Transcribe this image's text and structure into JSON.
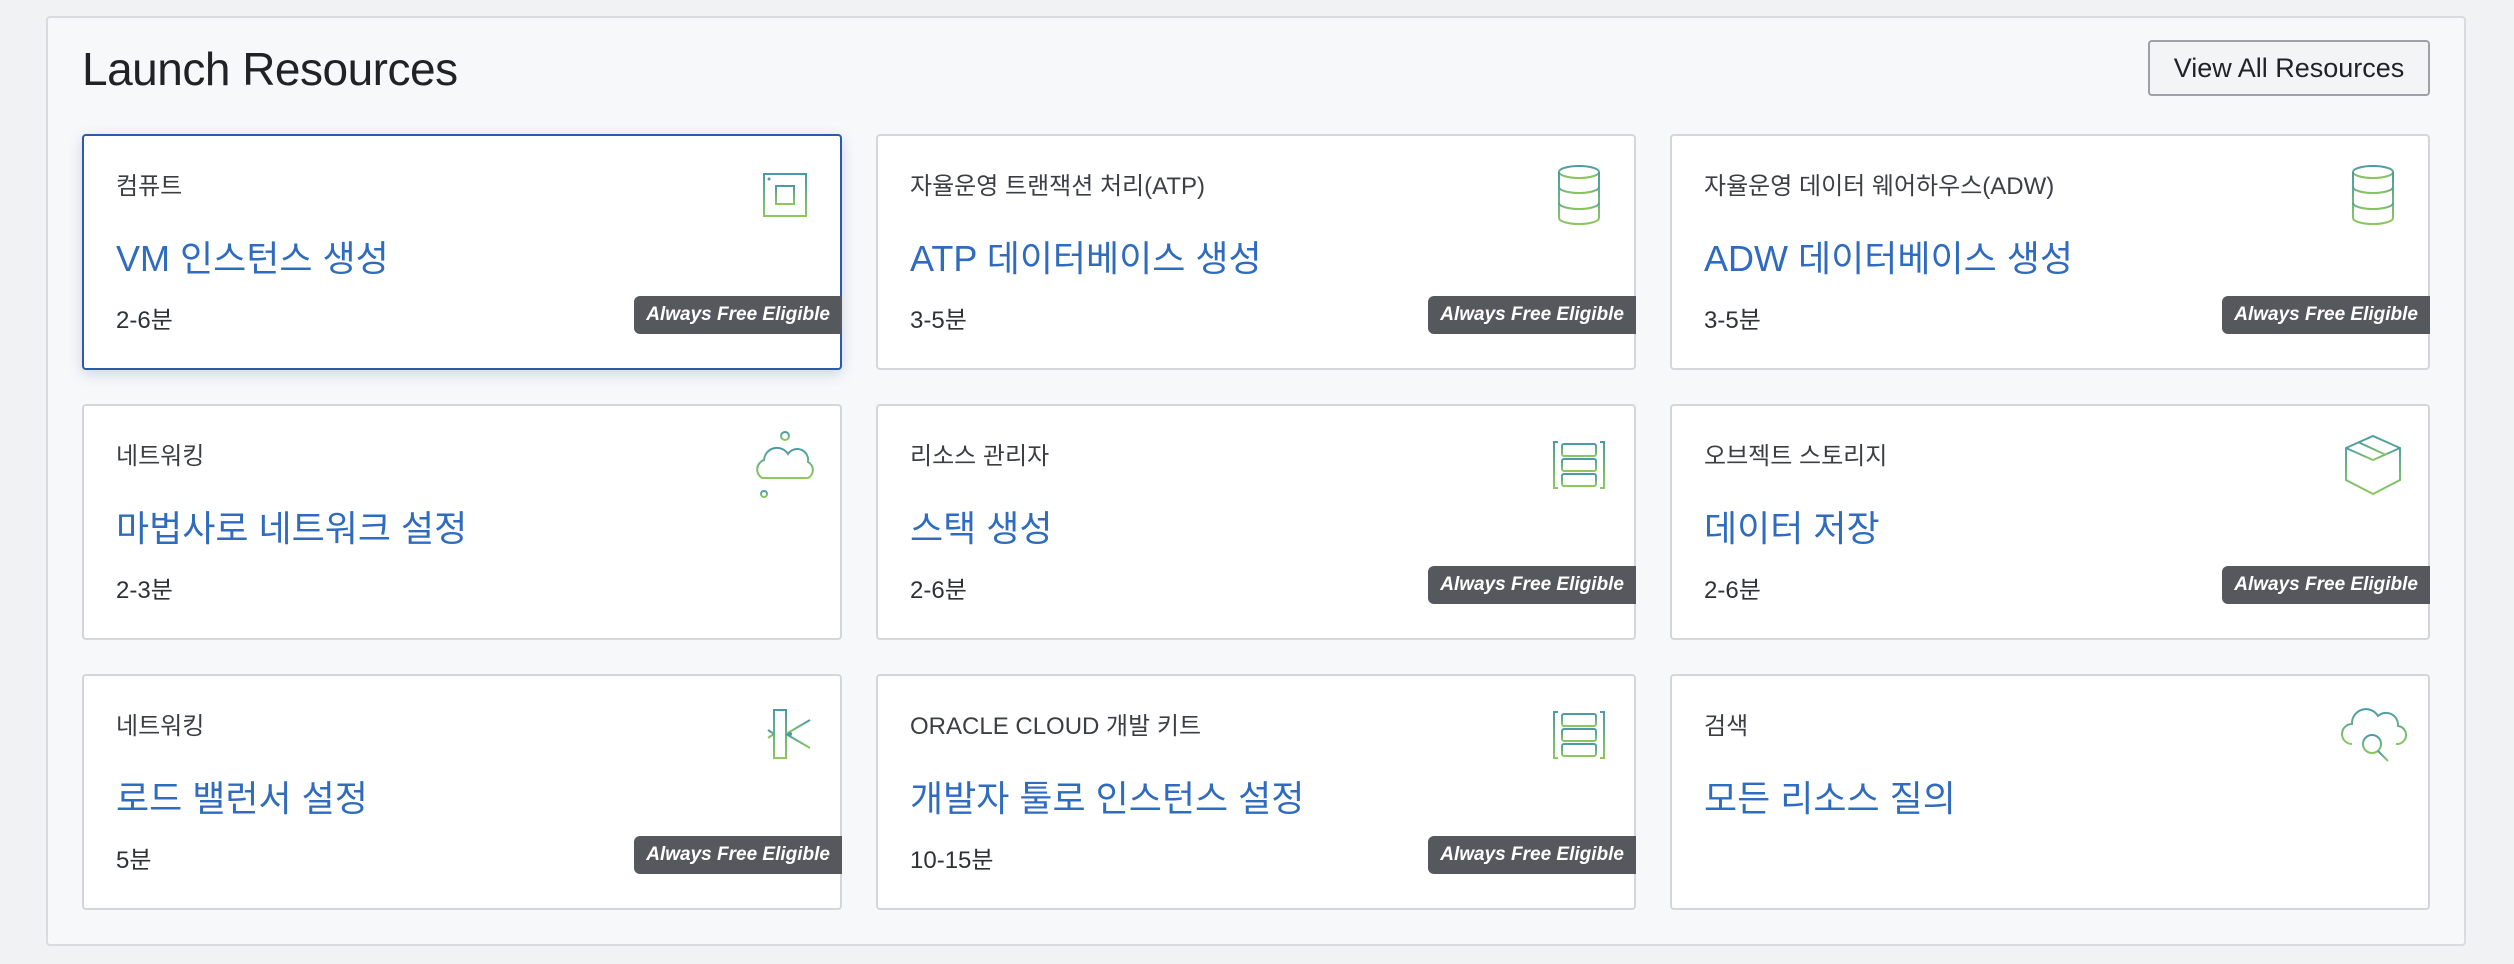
{
  "header": {
    "title": "Launch Resources",
    "view_all_label": "View All Resources"
  },
  "badge_label": "Always Free Eligible",
  "colors": {
    "link_blue": "#2f6bbf",
    "selected_border": "#2b5aa8",
    "badge_bg": "#55595e",
    "icon_green": "#7dbd6b",
    "icon_teal": "#4a9aa8"
  },
  "cards": [
    {
      "category": "컴퓨트",
      "title": "VM 인스턴스 생성",
      "time": "2-6분",
      "icon": "chip-icon",
      "always_free": true,
      "selected": true
    },
    {
      "category": "자율운영 트랜잭션 처리(ATP)",
      "title": "ATP 데이터베이스 생성",
      "time": "3-5분",
      "icon": "database-icon",
      "always_free": true
    },
    {
      "category": "자율운영 데이터 웨어하우스(ADW)",
      "title": "ADW 데이터베이스 생성",
      "time": "3-5분",
      "icon": "database-icon",
      "always_free": true
    },
    {
      "category": "네트워킹",
      "title": "마법사로 네트워크 설정",
      "time": "2-3분",
      "icon": "cloud-network-icon",
      "always_free": false
    },
    {
      "category": "리소스 관리자",
      "title": "스택 생성",
      "time": "2-6분",
      "icon": "stack-icon",
      "always_free": true
    },
    {
      "category": "오브젝트 스토리지",
      "title": "데이터 저장",
      "time": "2-6분",
      "icon": "box-icon",
      "always_free": true
    },
    {
      "category": "네트워킹",
      "title": "로드 밸런서 설정",
      "time": "5분",
      "icon": "load-balancer-icon",
      "always_free": true
    },
    {
      "category": "ORACLE CLOUD 개발 키트",
      "title": "개발자 툴로 인스턴스 설정",
      "time": "10-15분",
      "icon": "stack-icon",
      "always_free": true
    },
    {
      "category": "검색",
      "title": "모든 리소스 질의",
      "time": "",
      "icon": "cloud-search-icon",
      "always_free": false
    }
  ]
}
